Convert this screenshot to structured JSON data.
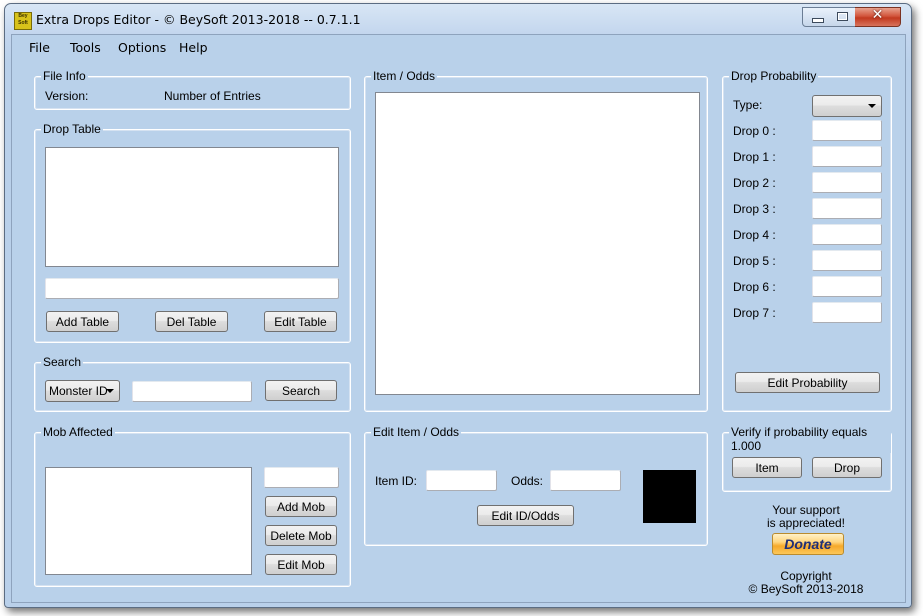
{
  "window": {
    "title": "Extra Drops Editor - © BeySoft  2013-2018  --  0.7.1.1",
    "app_icon_text": "Bey Soft",
    "controls": {
      "minimize": "minimize",
      "maximize": "maximize",
      "close": "✕"
    }
  },
  "menu": [
    "File",
    "Tools",
    "Options",
    "Help"
  ],
  "file_info": {
    "title": "File Info",
    "version_label": "Version:",
    "entries_label": "Number of Entries"
  },
  "drop_table": {
    "title": "Drop Table",
    "name_value": "",
    "buttons": {
      "add": "Add Table",
      "del": "Del Table",
      "edit": "Edit Table"
    }
  },
  "search": {
    "title": "Search",
    "type_selected": "Monster ID",
    "query_value": "",
    "button": "Search"
  },
  "mob_affected": {
    "title": "Mob Affected",
    "mob_value": "",
    "buttons": {
      "add": "Add Mob",
      "delete": "Delete Mob",
      "edit": "Edit Mob"
    }
  },
  "item_odds": {
    "title": "Item / Odds"
  },
  "edit_item_odds": {
    "title": "Edit Item / Odds",
    "item_id_label": "Item ID:",
    "item_id_value": "",
    "odds_label": "Odds:",
    "odds_value": "",
    "button": "Edit ID/Odds",
    "preview_color": "#000000"
  },
  "drop_probability": {
    "title": "Drop Probability",
    "type_label": "Type:",
    "type_selected": "",
    "drops": [
      {
        "label": "Drop 0 :",
        "value": ""
      },
      {
        "label": "Drop 1 :",
        "value": ""
      },
      {
        "label": "Drop 2 :",
        "value": ""
      },
      {
        "label": "Drop 3 :",
        "value": ""
      },
      {
        "label": "Drop 4 :",
        "value": ""
      },
      {
        "label": "Drop 5 :",
        "value": ""
      },
      {
        "label": "Drop 6 :",
        "value": ""
      },
      {
        "label": "Drop 7 :",
        "value": ""
      }
    ],
    "button": "Edit Probability"
  },
  "verify": {
    "title": "Verify if probability equals 1.000",
    "item_button": "Item",
    "drop_button": "Drop"
  },
  "support": {
    "line1": "Your support",
    "line2": "is appreciated!",
    "donate": "Donate",
    "copyright1": "Copyright",
    "copyright2": "© BeySoft  2013-2018"
  }
}
